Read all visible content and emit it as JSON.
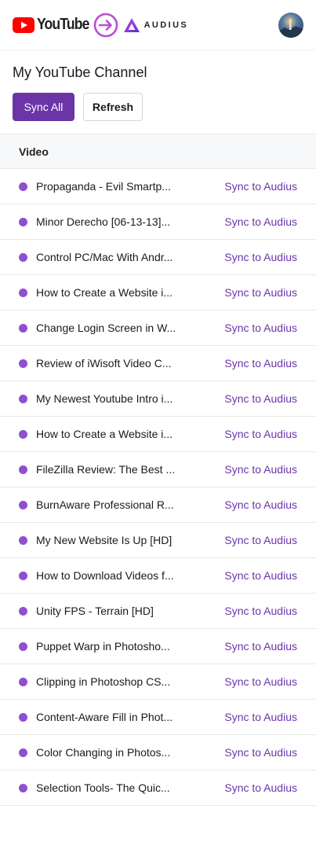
{
  "header": {
    "youtube_word": "YouTube",
    "audius_word": "AUDIUS",
    "colors": {
      "youtube_red": "#ff0000",
      "accent_purple": "#6b35a8",
      "arrow_ring": "#b84fd1"
    }
  },
  "page": {
    "title": "My YouTube Channel"
  },
  "actions": {
    "sync_all_label": "Sync All",
    "refresh_label": "Refresh"
  },
  "table": {
    "column_header": "Video",
    "sync_label": "Sync to Audius",
    "rows": [
      {
        "title": "Propaganda - Evil Smartp..."
      },
      {
        "title": "Minor Derecho [06-13-13]..."
      },
      {
        "title": "Control PC/Mac With Andr..."
      },
      {
        "title": "How to Create a Website i..."
      },
      {
        "title": "Change Login Screen in W..."
      },
      {
        "title": "Review of iWisoft Video C..."
      },
      {
        "title": "My Newest Youtube Intro i..."
      },
      {
        "title": "How to Create a Website i..."
      },
      {
        "title": "FileZilla Review: The Best ..."
      },
      {
        "title": "BurnAware Professional R..."
      },
      {
        "title": "My New Website Is Up [HD]"
      },
      {
        "title": "How to Download Videos f..."
      },
      {
        "title": "Unity FPS - Terrain [HD]"
      },
      {
        "title": "Puppet Warp in Photosho..."
      },
      {
        "title": "Clipping in Photoshop CS..."
      },
      {
        "title": "Content-Aware Fill in Phot..."
      },
      {
        "title": "Color Changing in Photos..."
      },
      {
        "title": "Selection Tools- The Quic..."
      }
    ]
  }
}
